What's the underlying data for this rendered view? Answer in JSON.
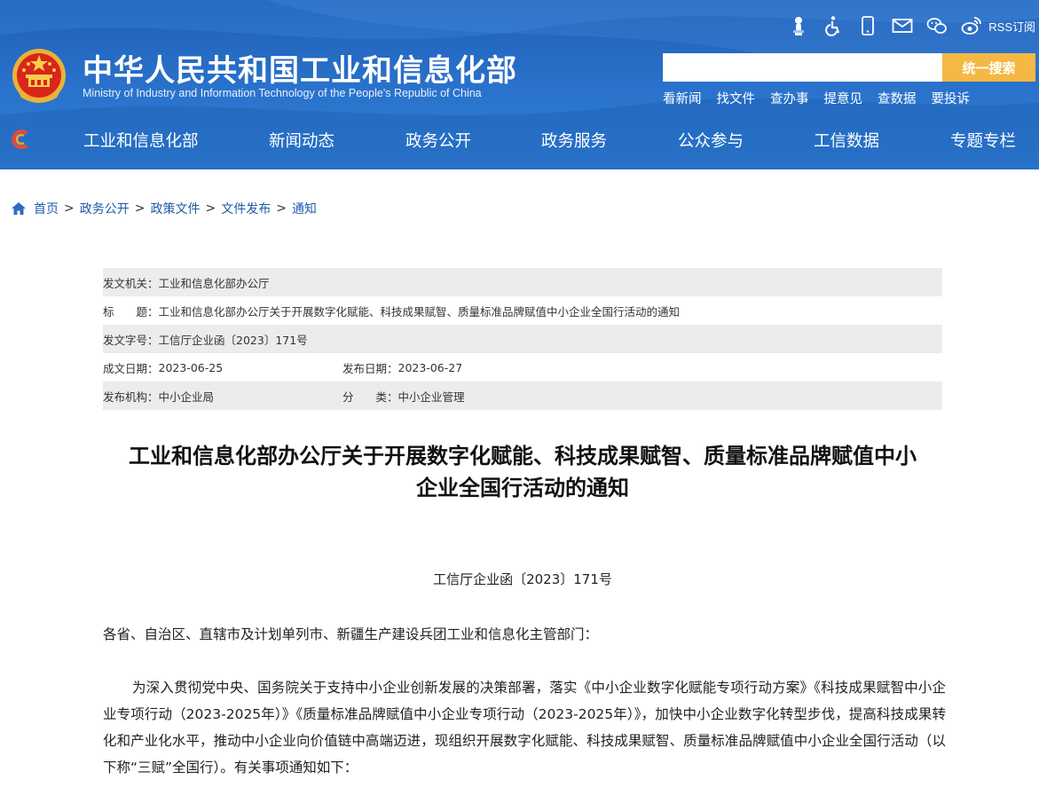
{
  "header": {
    "site_name": "中华人民共和国工业和信息化部",
    "site_name_en": "Ministry of Industry and Information Technology of the People's Republic of China",
    "rss_label": "RSS订阅",
    "search_placeholder": "",
    "search_button": "统一搜索",
    "quick_links": [
      "看新闻",
      "找文件",
      "查办事",
      "提意见",
      "查数据",
      "要投诉"
    ],
    "nav": [
      "工业和信息化部",
      "新闻动态",
      "政务公开",
      "政务服务",
      "公众参与",
      "工信数据",
      "专题专栏"
    ],
    "colors": {
      "header_blue": "#2a73cc",
      "search_button": "#f4b843"
    },
    "icons": [
      "accessibility-elder-icon",
      "wheelchair-icon",
      "mobile-icon",
      "mail-icon",
      "wechat-icon",
      "weibo-icon"
    ]
  },
  "breadcrumb": [
    "首页",
    "政务公开",
    "政策文件",
    "文件发布",
    "通知"
  ],
  "meta": {
    "issuer_label": "发文机关：",
    "issuer": "工业和信息化部办公厅",
    "title_label": "标　　题：",
    "title": "工业和信息化部办公厅关于开展数字化赋能、科技成果赋智、质量标准品牌赋值中小企业全国行活动的通知",
    "docno_label": "发文字号：",
    "docno": "工信厅企业函〔2023〕171号",
    "created_label": "成文日期：",
    "created": "2023-06-25",
    "published_label": "发布日期：",
    "published": "2023-06-27",
    "org_label": "发布机构：",
    "org": "中小企业局",
    "category_label": "分　　类：",
    "category": "中小企业管理"
  },
  "article": {
    "title_line1": "工业和信息化部办公厅关于开展数字化赋能、科技成果赋智、质量标准品牌赋值中小",
    "title_line2": "企业全国行活动的通知",
    "doc_number": "工信厅企业函〔2023〕171号",
    "salutation": "各省、自治区、直辖市及计划单列市、新疆生产建设兵团工业和信息化主管部门：",
    "body": "为深入贯彻党中央、国务院关于支持中小企业创新发展的决策部署，落实《中小企业数字化赋能专项行动方案》《科技成果赋智中小企业专项行动（2023-2025年）》《质量标准品牌赋值中小企业专项行动（2023-2025年）》，加快中小企业数字化转型步伐，提高科技成果转化和产业化水平，推动中小企业向价值链中高端迈进，现组织开展数字化赋能、科技成果赋智、质量标准品牌赋值中小企业全国行活动（以下称“三赋”全国行）。有关事项通知如下："
  }
}
